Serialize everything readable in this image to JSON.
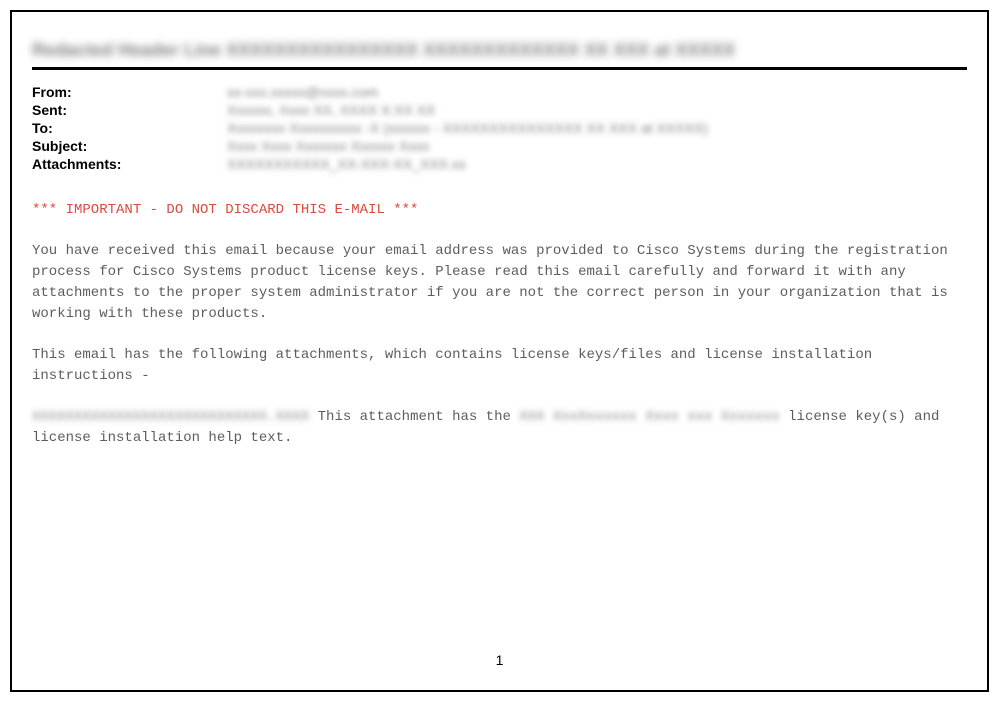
{
  "header_title_blurred": "Redacted Header Line XXXXXXXXXXXXXXXX XXXXXXXXXXXXX XX XXX at XXXXX",
  "headers": {
    "from_label": "From:",
    "from_value": "xx-xxx.xxxxx@xxxx.com",
    "sent_label": "Sent:",
    "sent_value": "Xxxxxx, Xxxx XX, XXXX X:XX XX",
    "to_label": "To:",
    "to_value": "Xxxxxxxx Xxxxxxxxxx -X (xxxxxx - XXXXXXXXXXXXXXX XX XXX at XXXXX)",
    "subject_label": "Subject:",
    "subject_value": "Xxxx Xxxx Xxxxxxx Xxxxxx Xxxx",
    "attachments_label": "Attachments:",
    "attachments_value": "XXXXXXXXXXX_XX-XXX-XX_XXX.xx"
  },
  "body": {
    "warning": "*** IMPORTANT - DO NOT DISCARD THIS E-MAIL ***",
    "para1": "You have received this email because your email address was provided to Cisco Systems during the registration process for Cisco Systems product license keys.  Please read this email carefully and forward it with any attachments to the proper system administrator if you are not the correct person in your organization that is working with these products.",
    "para2": "This email has the following attachments, which contains license keys/files and license installation instructions -",
    "attach_name_blurred": "XXXXXXXXXXXXXXXXXXXXXXXXXXXX.XXXX",
    "para3_pre": " This attachment has the ",
    "product_blurred": "XXX XxxXxxxxxx  Xxxx xxx Xxxxxxx",
    "para3_post": " license key(s) and license installation help text."
  },
  "page_number": "1"
}
